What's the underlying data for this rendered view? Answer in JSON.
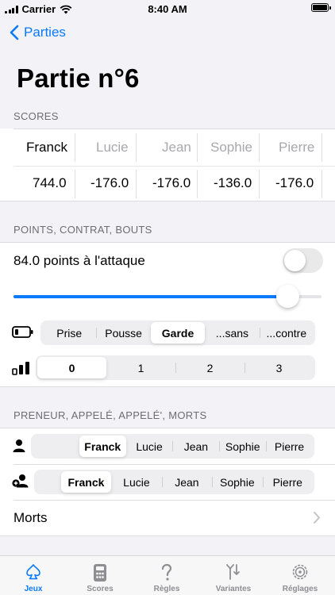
{
  "status": {
    "carrier": "Carrier",
    "time": "8:40 AM"
  },
  "nav": {
    "back_label": "Parties"
  },
  "title": "Partie n°6",
  "sections": {
    "scores": "SCORES",
    "points": "POINTS, CONTRAT, BOUTS",
    "preneur": "PRENEUR, APPELÉ, APPELÉ', MORTS"
  },
  "scores": {
    "players": [
      "Franck",
      "Lucie",
      "Jean",
      "Sophie",
      "Pierre"
    ],
    "values": [
      "744.0",
      "-176.0",
      "-176.0",
      "-136.0",
      "-176.0"
    ],
    "active_index": 0
  },
  "attack": {
    "label": "84.0 points à l'attaque",
    "toggle_on": false,
    "slider_fraction": 0.89
  },
  "contrat": {
    "options": [
      "Prise",
      "Pousse",
      "Garde",
      "...sans",
      "...contre"
    ],
    "selected": "Garde"
  },
  "bouts": {
    "options": [
      "0",
      "1",
      "2",
      "3"
    ],
    "selected": "0"
  },
  "preneur": {
    "options": [
      "",
      "Franck",
      "Lucie",
      "Jean",
      "Sophie",
      "Pierre"
    ],
    "selected": "Franck"
  },
  "appele": {
    "options": [
      "",
      "Franck",
      "Lucie",
      "Jean",
      "Sophie",
      "Pierre"
    ],
    "selected": "Franck"
  },
  "morts": {
    "label": "Morts"
  },
  "tabs": [
    {
      "label": "Jeux",
      "icon": "spade-icon",
      "active": true
    },
    {
      "label": "Scores",
      "icon": "scores-icon",
      "active": false
    },
    {
      "label": "Règles",
      "icon": "question-icon",
      "active": false
    },
    {
      "label": "Variantes",
      "icon": "variants-icon",
      "active": false
    },
    {
      "label": "Réglages",
      "icon": "gear-icon",
      "active": false
    }
  ],
  "colors": {
    "accent": "#0a7aff",
    "background": "#f2f2f7",
    "secondary_text": "#6d6d72"
  }
}
